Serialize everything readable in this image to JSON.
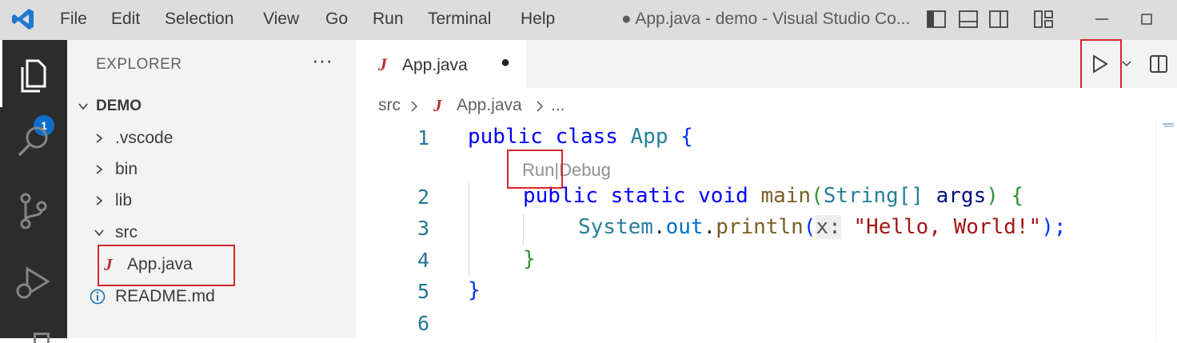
{
  "titlebar": {
    "menu": [
      "File",
      "Edit",
      "Selection",
      "View",
      "Go",
      "Run",
      "Terminal",
      "Help"
    ],
    "title": "● App.java - demo - Visual Studio Co...",
    "icons": [
      "vscode-logo",
      "toggle-primary-sidebar",
      "toggle-panel",
      "toggle-secondary-sidebar",
      "customize-layout",
      "minimize"
    ]
  },
  "activitybar": {
    "explorer_badge": "1",
    "icons": [
      "explorer-icon",
      "search-icon",
      "source-control-icon",
      "run-debug-icon"
    ]
  },
  "sidebar": {
    "title": "EXPLORER",
    "more": "···",
    "root": "DEMO",
    "items": [
      {
        "label": ".vscode",
        "type": "folder",
        "expanded": false
      },
      {
        "label": "bin",
        "type": "folder",
        "expanded": false
      },
      {
        "label": "lib",
        "type": "folder",
        "expanded": false
      },
      {
        "label": "src",
        "type": "folder",
        "expanded": true
      },
      {
        "label": "App.java",
        "type": "java-file",
        "icon_text": "J"
      },
      {
        "label": "README.md",
        "type": "info-file"
      }
    ]
  },
  "editor": {
    "tab": {
      "label": "App.java",
      "icon_text": "J",
      "dirty_dot": "●"
    },
    "breadcrumb": {
      "folder": "src",
      "file": "App.java",
      "rest": "..."
    },
    "codelens": {
      "run": "Run",
      "sep": "|",
      "debug": "Debug"
    },
    "line_numbers": [
      "1",
      "2",
      "3",
      "4",
      "5",
      "6"
    ],
    "code": {
      "l1_kw1": "public",
      "l1_kw2": "class",
      "l1_name": "App",
      "l1_brace": "{",
      "l2_kw1": "public",
      "l2_kw2": "static",
      "l2_kw3": "void",
      "l2_fn": "main",
      "l2_paren_open": "(",
      "l2_type": "String[]",
      "l2_arg": "args",
      "l2_paren_close": ")",
      "l2_brace": "{",
      "l3_sys": "System",
      "l3_dot1": ".",
      "l3_out": "out",
      "l3_dot2": ".",
      "l3_fn": "println",
      "l3_paren_open": "(",
      "l3_hint": "x:",
      "l3_str": "\"Hello, World!\"",
      "l3_end": ");",
      "l4_brace": "}",
      "l5_brace": "}"
    }
  },
  "colors": {
    "highlight_box": "#d6262b",
    "java_icon": "#b52e31",
    "accent": "#0b6fc9"
  }
}
